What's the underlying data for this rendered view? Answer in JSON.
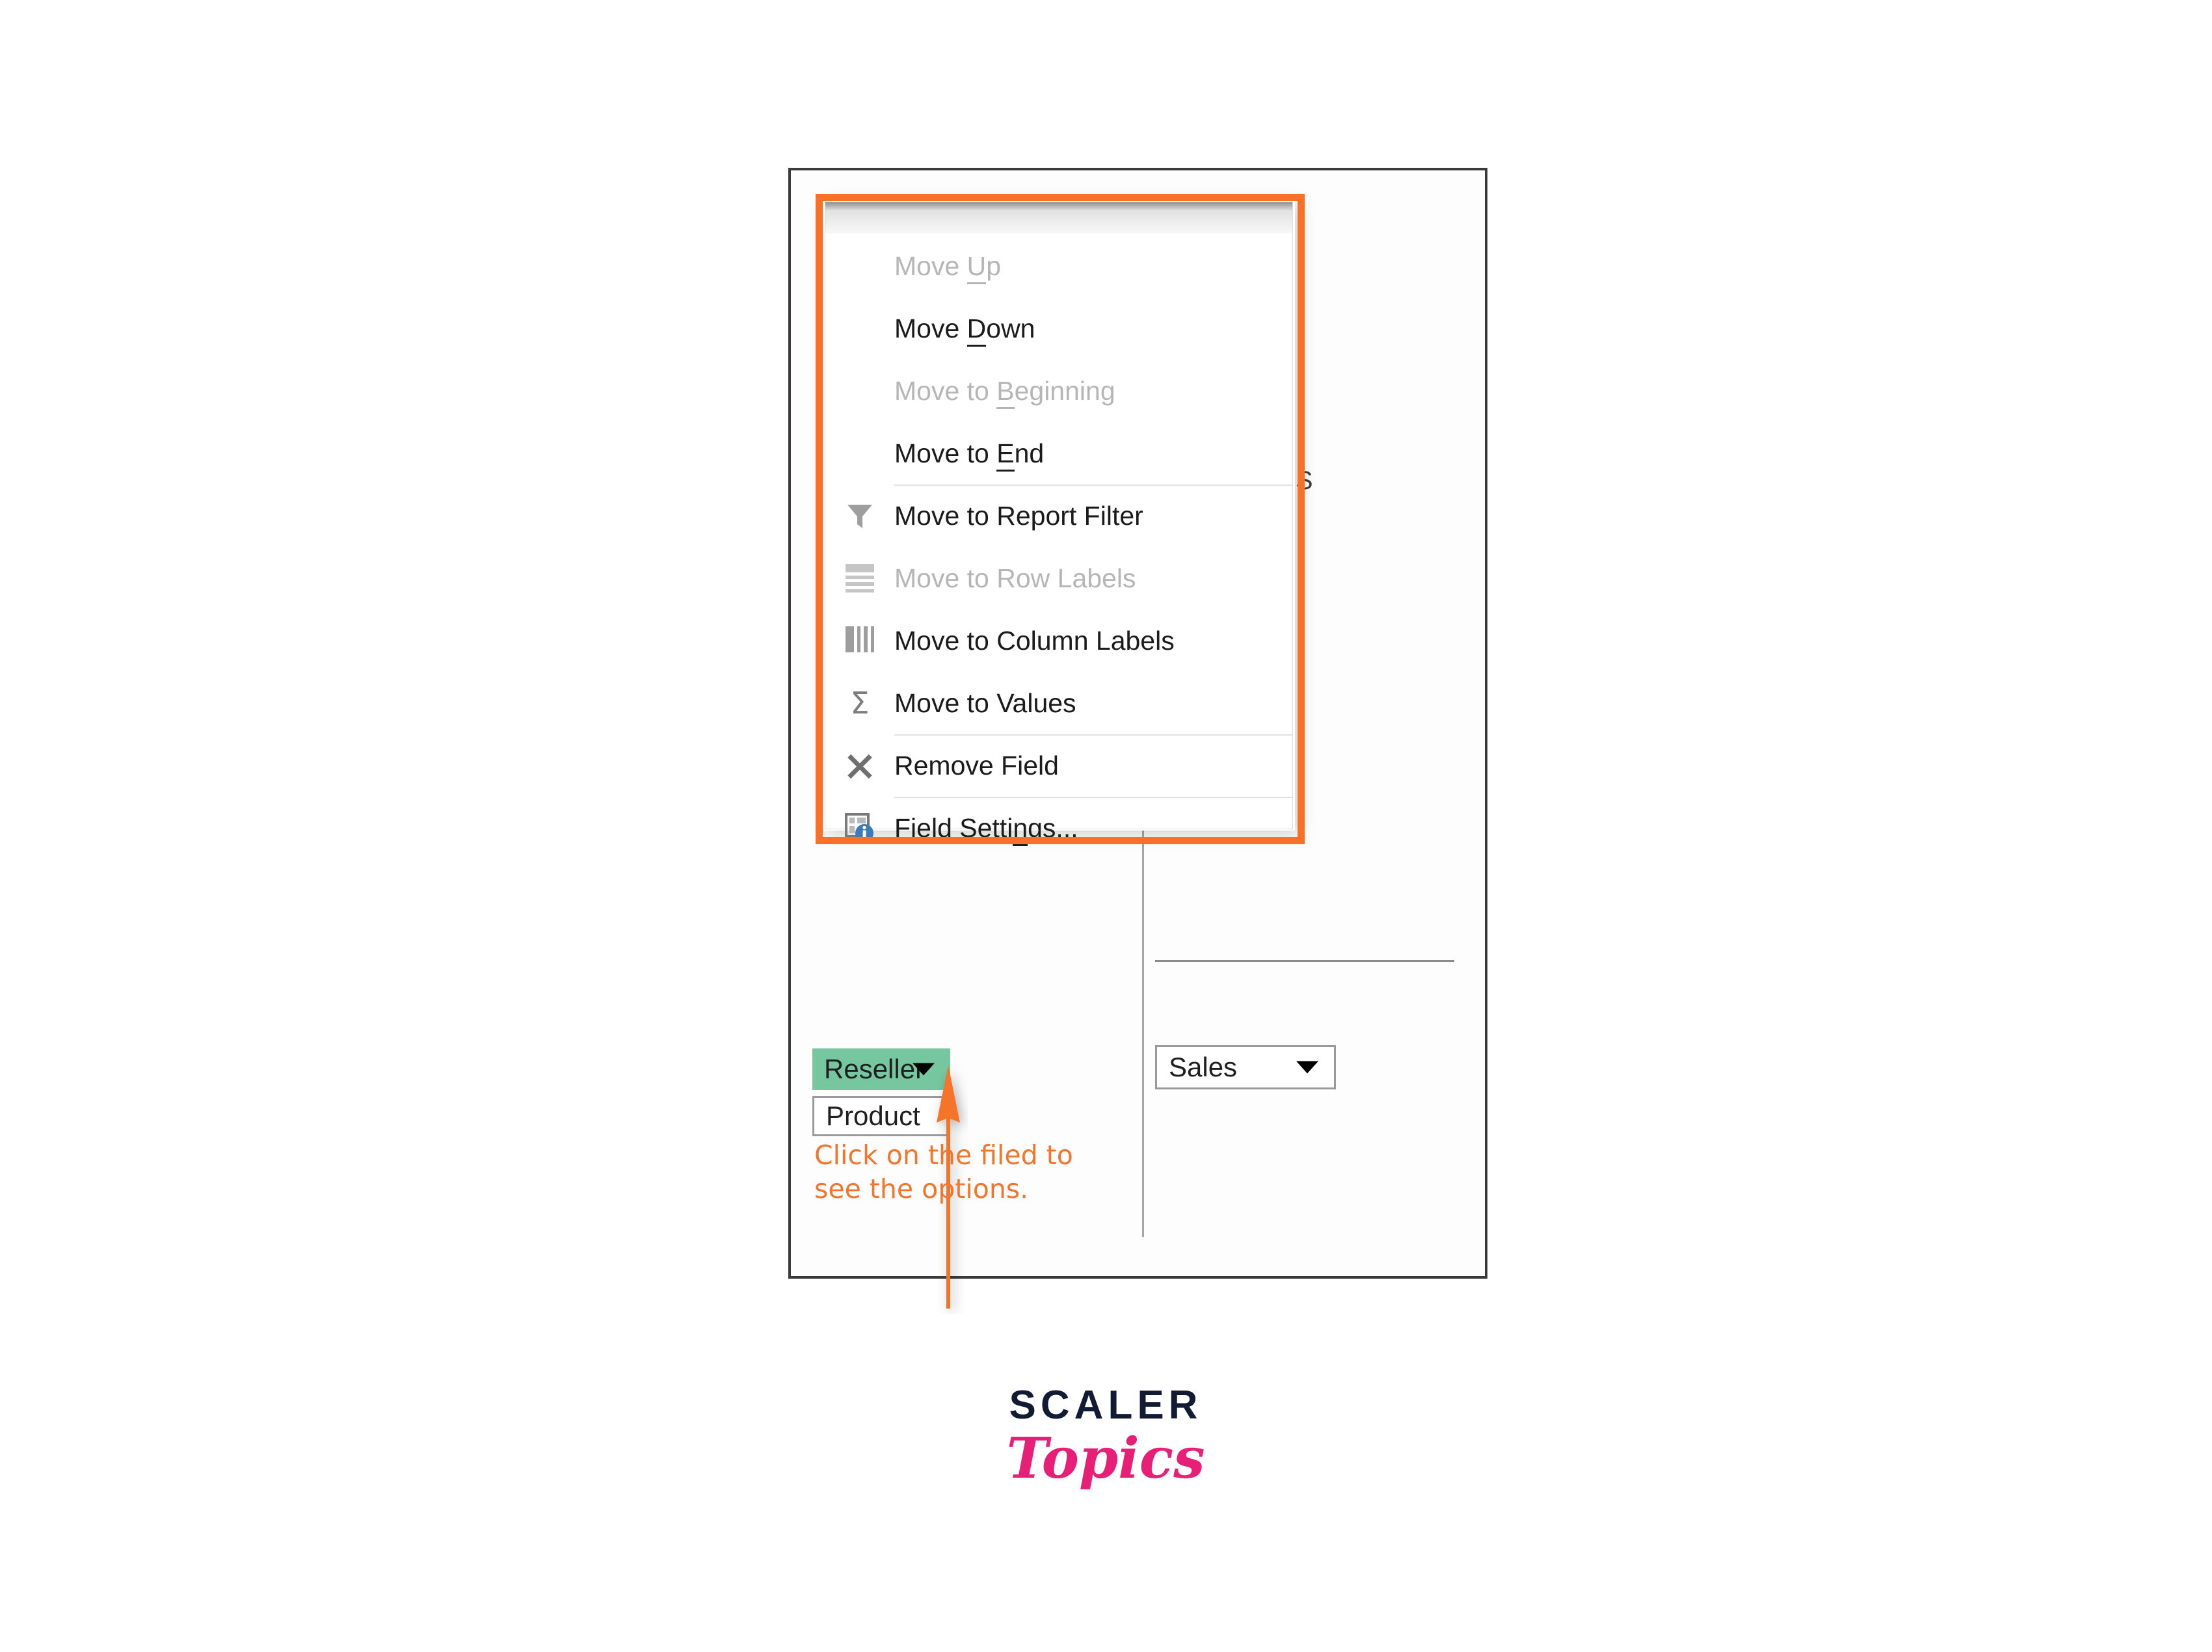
{
  "app": {
    "pane_caption_partial": "NS"
  },
  "menu": {
    "name": "pivot-field-context-menu",
    "items": [
      {
        "label": "Move Up",
        "label_pre": "Move ",
        "accel": "U",
        "label_post": "p",
        "icon": "none",
        "disabled": true,
        "separator_above": false
      },
      {
        "label": "Move Down",
        "label_pre": "Move ",
        "accel": "D",
        "label_post": "own",
        "icon": "none",
        "disabled": false,
        "separator_above": false
      },
      {
        "label": "Move to Beginning",
        "label_pre": "Move to ",
        "accel": "B",
        "label_post": "eginning",
        "icon": "none",
        "disabled": true,
        "separator_above": false
      },
      {
        "label": "Move to End",
        "label_pre": "Move to ",
        "accel": "E",
        "label_post": "nd",
        "icon": "none",
        "disabled": false,
        "separator_above": false
      },
      {
        "label": "Move to Report Filter",
        "label_pre": "Move to Report Filter",
        "accel": "",
        "label_post": "",
        "icon": "filter-icon",
        "disabled": false,
        "separator_above": true
      },
      {
        "label": "Move to Row Labels",
        "label_pre": "Move to Row Labels",
        "accel": "",
        "label_post": "",
        "icon": "row-labels-icon",
        "disabled": true,
        "separator_above": false
      },
      {
        "label": "Move to Column Labels",
        "label_pre": "Move to Column Labels",
        "accel": "",
        "label_post": "",
        "icon": "column-labels-icon",
        "disabled": false,
        "separator_above": false
      },
      {
        "label": "Move to Values",
        "label_pre": "Move to Values",
        "accel": "",
        "label_post": "",
        "icon": "sigma-icon",
        "disabled": false,
        "separator_above": false
      },
      {
        "label": "Remove Field",
        "label_pre": "Remove Field",
        "accel": "",
        "label_post": "",
        "icon": "close-x-icon",
        "disabled": false,
        "separator_above": true
      },
      {
        "label": "Field Settings...",
        "label_pre": "Field Setti",
        "accel": "n",
        "label_post": "gs...",
        "icon": "field-settings-icon",
        "disabled": false,
        "separator_above": true
      }
    ]
  },
  "fields": {
    "rows_area": [
      {
        "label": "Reseller",
        "selected": true,
        "has_caret": true
      },
      {
        "label": "Product",
        "selected": false,
        "has_caret": false
      }
    ],
    "values_area": [
      {
        "label": "Sales",
        "selected": false,
        "has_caret": true
      }
    ]
  },
  "annotation": {
    "line1": "Click on the filed to",
    "line2": "see the options."
  },
  "logo": {
    "primary": "SCALER",
    "secondary": "Topics"
  },
  "colors": {
    "highlight_orange": "#f97028",
    "annotation_orange": "#f4752c",
    "selected_field_green": "#76c7a0",
    "menu_text": "#1b1b1b",
    "menu_text_disabled": "#b6b6b6",
    "frame_border": "#3a3a3a",
    "logo_primary": "#121b33",
    "logo_secondary": "#e81f76"
  }
}
